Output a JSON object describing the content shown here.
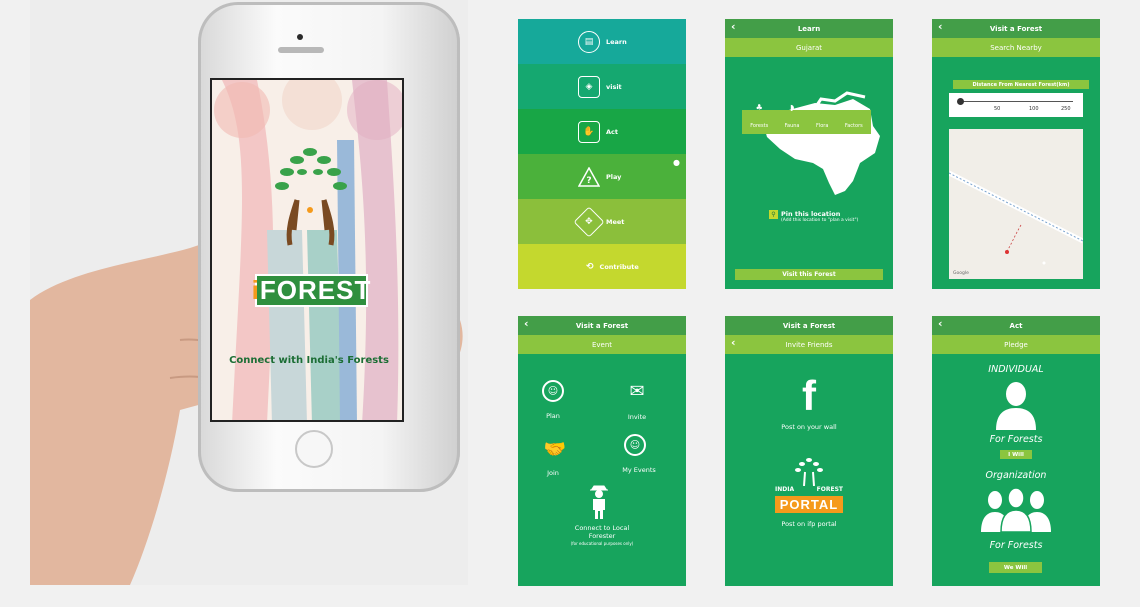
{
  "phone": {
    "brand_i": "i",
    "brand_rest": "FOREST",
    "tagline": "Connect with India's Forests"
  },
  "menu": {
    "items": [
      {
        "label": "Learn",
        "icon": "book-icon",
        "color": "#16a99a"
      },
      {
        "label": "visit",
        "icon": "compass-icon",
        "color": "#15a870"
      },
      {
        "label": "Act",
        "icon": "hand-icon",
        "color": "#18a646"
      },
      {
        "label": "Play",
        "icon": "question-icon",
        "color": "#4bb13b"
      },
      {
        "label": "Meet",
        "icon": "people-icon",
        "color": "#8bbf3b"
      },
      {
        "label": "Contribute",
        "icon": "contribute-icon",
        "color": "#c4d82e"
      }
    ]
  },
  "learn": {
    "title": "Learn",
    "subtitle": "Gujarat",
    "tabs": [
      "Forests",
      "Fauna",
      "Flora",
      "Factors"
    ],
    "pin_title": "Pin this location",
    "pin_note": "(Add this location to \"plan a visit\")",
    "button": "Visit this Forest"
  },
  "search": {
    "title": "Visit a Forest",
    "subtitle": "Search Nearby",
    "distance_label": "Distance From Nearest Forest(km)",
    "ticks": [
      "50",
      "100",
      "250"
    ],
    "map_credit": "Google"
  },
  "event": {
    "title": "Visit a Forest",
    "subtitle": "Event",
    "plan": "Plan",
    "invite": "Invite",
    "join": "Join",
    "my_events": "My Events",
    "connect_line1": "Connect to Local",
    "connect_line2": "Forester",
    "connect_note": "(for educational purposes only)"
  },
  "invite": {
    "title": "Visit a Forest",
    "subtitle": "Invite Friends",
    "wall": "Post on your wall",
    "portal_top_left": "INDIA",
    "portal_top_right": "FOREST",
    "portal_word": "PORTAL",
    "ifp": "Post on ifp portal"
  },
  "act": {
    "title": "Act",
    "subtitle": "Pledge",
    "individual": "INDIVIDUAL",
    "for_forests_1": "For Forests",
    "i_will": "I Will",
    "organization": "Organization",
    "for_forests_2": "For Forests",
    "we_will": "We Will"
  },
  "colors": {
    "header": "#439e48",
    "subheader": "#8bc53f",
    "body": "#17a45d",
    "brand_orange": "#f59a1b"
  }
}
